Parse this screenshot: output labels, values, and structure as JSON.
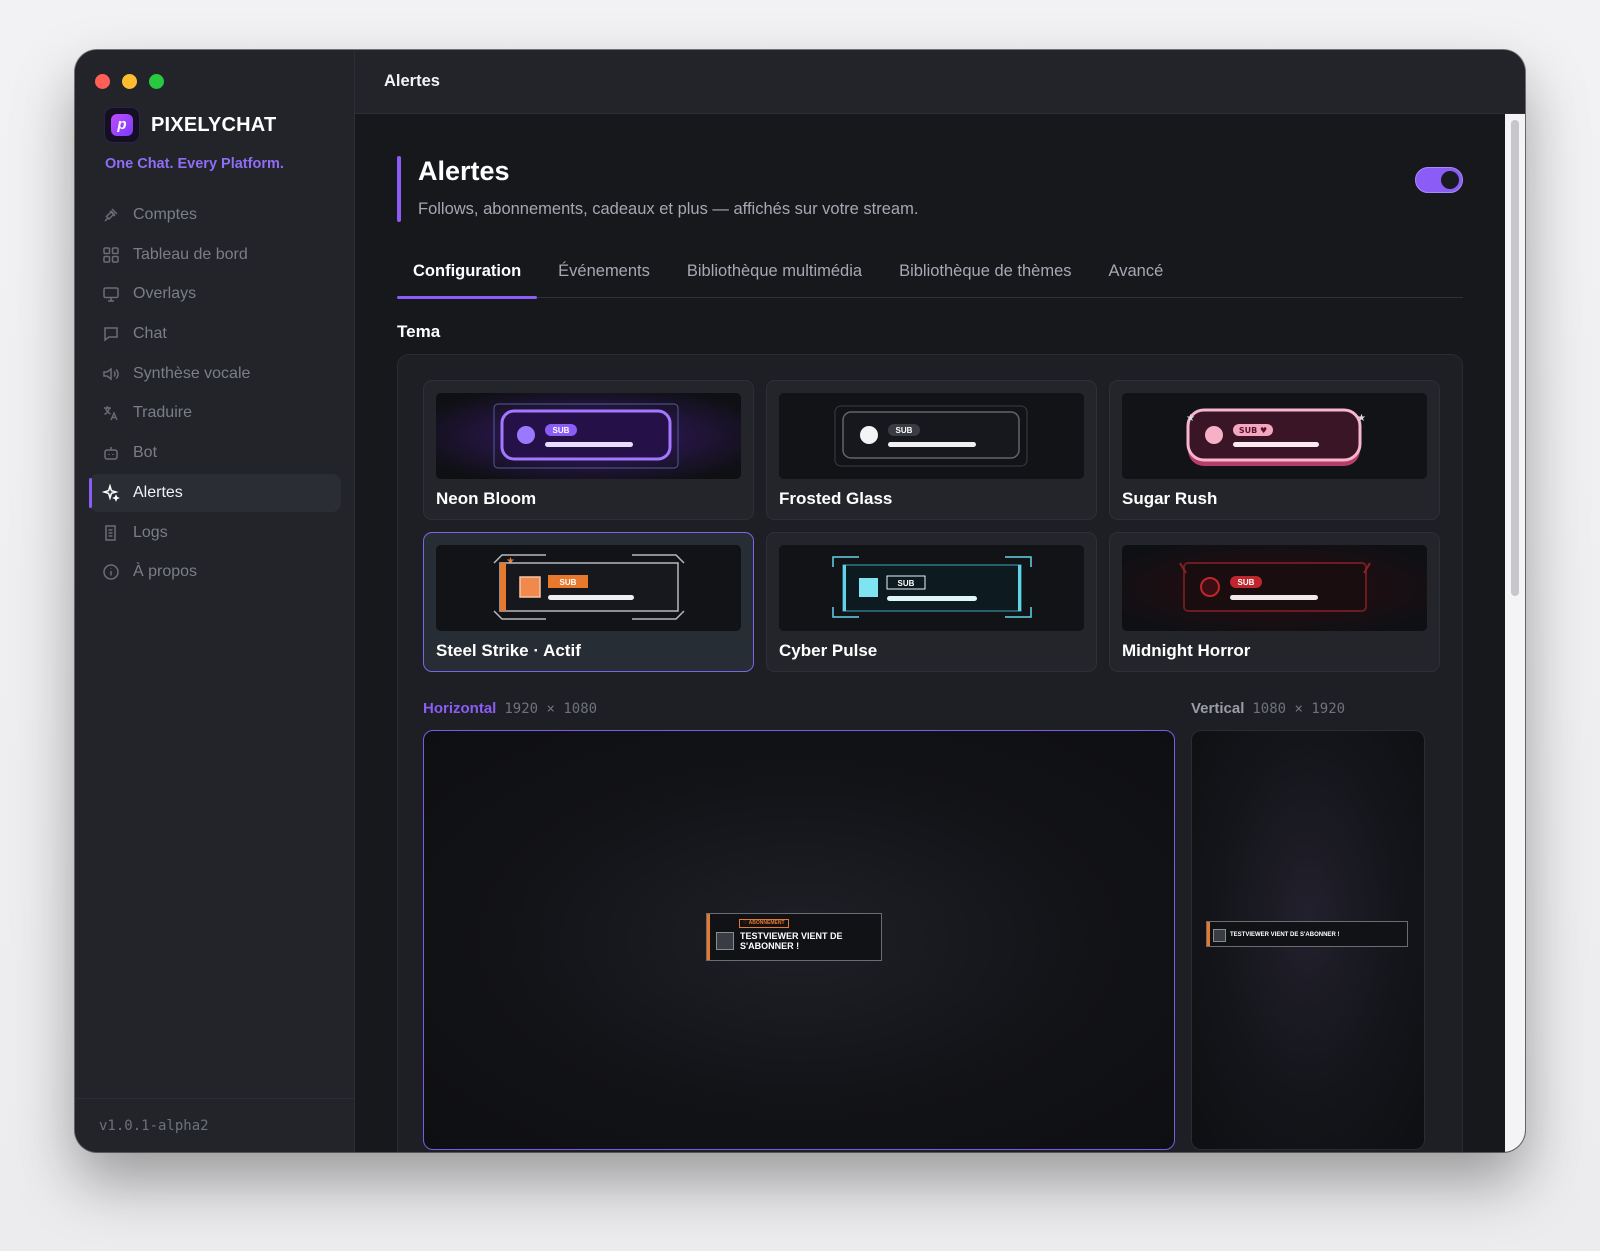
{
  "app": {
    "brand_name": "PIXELYCHAT",
    "tagline": "One Chat. Every Platform.",
    "version": "v1.0.1-alpha2",
    "accent_color": "#8b5cf6"
  },
  "sidebar": {
    "items": [
      {
        "label": "Comptes",
        "icon": "plug-icon"
      },
      {
        "label": "Tableau de bord",
        "icon": "grid-icon"
      },
      {
        "label": "Overlays",
        "icon": "monitor-icon"
      },
      {
        "label": "Chat",
        "icon": "chat-bubble-icon"
      },
      {
        "label": "Synthèse vocale",
        "icon": "speaker-icon"
      },
      {
        "label": "Traduire",
        "icon": "translate-icon"
      },
      {
        "label": "Bot",
        "icon": "robot-icon"
      },
      {
        "label": "Alertes",
        "icon": "sparkle-icon",
        "active": true
      },
      {
        "label": "Logs",
        "icon": "log-icon"
      },
      {
        "label": "À propos",
        "icon": "info-icon"
      }
    ]
  },
  "topbar": {
    "title": "Alertes"
  },
  "page": {
    "title": "Alertes",
    "subtitle": "Follows, abonnements, cadeaux et plus — affichés sur votre stream.",
    "enabled": true
  },
  "tabs": [
    {
      "label": "Configuration",
      "active": true
    },
    {
      "label": "Événements"
    },
    {
      "label": "Bibliothèque multimédia"
    },
    {
      "label": "Bibliothèque de thèmes"
    },
    {
      "label": "Avancé"
    }
  ],
  "theme_section": {
    "label": "Tema",
    "themes": [
      {
        "name": "Neon Bloom",
        "badge": "SUB",
        "color": "#8b5cf6"
      },
      {
        "name": "Frosted Glass",
        "badge": "SUB",
        "color": "#e8e8ee"
      },
      {
        "name": "Sugar Rush",
        "badge": "SUB ♥",
        "color": "#f07aa0"
      },
      {
        "name": "Steel Strike · Actif",
        "badge": "SUB",
        "color": "#e7782c",
        "active": true
      },
      {
        "name": "Cyber Pulse",
        "badge": "SUB",
        "color": "#5fd4e8"
      },
      {
        "name": "Midnight Horror",
        "badge": "SUB",
        "color": "#c0262d"
      }
    ]
  },
  "previews": {
    "horizontal": {
      "label": "Horizontal",
      "size": "1920 × 1080"
    },
    "vertical": {
      "label": "Vertical",
      "size": "1080 × 1920"
    },
    "alert_tag": "♡ ABONNEMENT",
    "alert_text_h": "TESTVIEWER VIENT DE S'ABONNER !",
    "alert_text_v": "TESTVIEWER VIENT DE S'ABONNER !"
  }
}
